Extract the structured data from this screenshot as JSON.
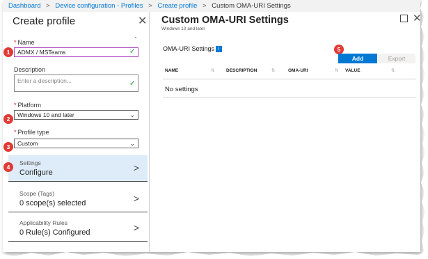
{
  "breadcrumb": {
    "items": [
      "Dashboard",
      "Device configuration - Profiles",
      "Create profile",
      "Custom OMA-URI Settings"
    ]
  },
  "left_panel": {
    "title": "Create profile",
    "name": {
      "label": "Name",
      "value": "ADMX / MSTeams"
    },
    "description": {
      "label": "Description",
      "placeholder": "Enter a description..."
    },
    "platform": {
      "label": "Platform",
      "value": "Windows 10 and later"
    },
    "profile_type": {
      "label": "Profile type",
      "value": "Custom"
    },
    "nav": [
      {
        "title": "Settings",
        "value": "Configure"
      },
      {
        "title": "Scope (Tags)",
        "value": "0 scope(s) selected"
      },
      {
        "title": "Applicability Rules",
        "value": "0 Rule(s) Configured"
      }
    ]
  },
  "right_panel": {
    "title": "Custom OMA-URI Settings",
    "subtitle": "Windows 10 and later",
    "section_label": "OMA-URI Settings",
    "add_label": "Add",
    "export_label": "Export",
    "columns": [
      "NAME",
      "DESCRIPTION",
      "OMA-URI",
      "VALUE"
    ],
    "empty_text": "No settings"
  },
  "badges": [
    "1",
    "2",
    "3",
    "4",
    "5"
  ],
  "colors": {
    "accent": "#0078d4",
    "badge": "#e03b35",
    "active_nav": "#deecf9",
    "check": "#2e9e48"
  }
}
